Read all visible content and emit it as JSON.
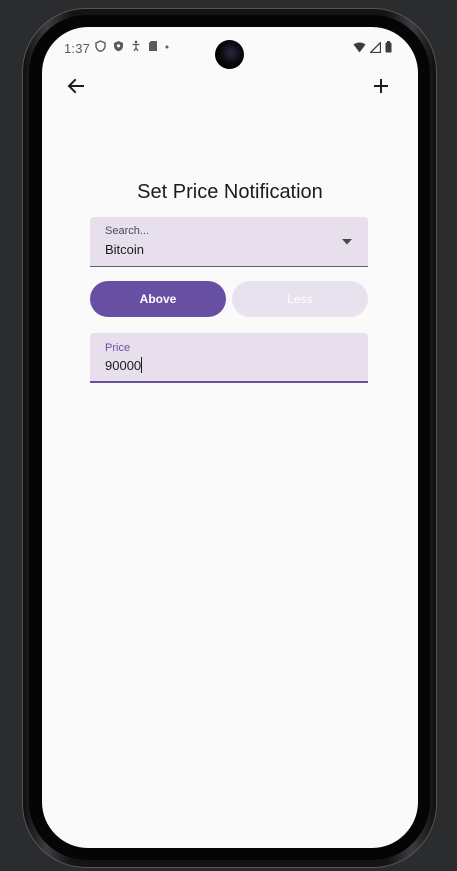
{
  "status_bar": {
    "time": "1:37"
  },
  "app_bar": {
    "back_icon": "arrow-back-icon",
    "add_icon": "add-icon"
  },
  "page": {
    "title": "Set Price Notification"
  },
  "search_dropdown": {
    "label": "Search...",
    "value": "Bitcoin"
  },
  "direction_toggle": {
    "above_label": "Above",
    "less_label": "Less",
    "selected": "Above"
  },
  "price_input": {
    "label": "Price",
    "value": "90000"
  },
  "colors": {
    "primary": "#6750a4",
    "field_bg": "#e7e0ec",
    "screen_bg": "#fafafa"
  }
}
